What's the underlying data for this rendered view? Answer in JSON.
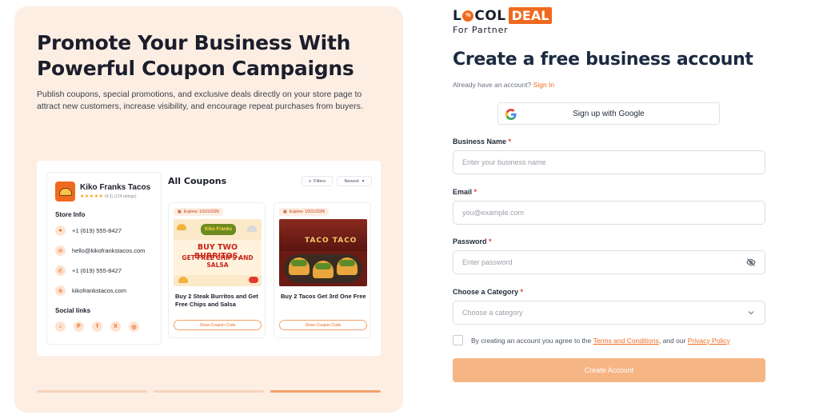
{
  "hero": {
    "title": "Promote Your Business With Powerful Coupon Campaigns",
    "description": "Publish coupons, special promotions, and exclusive deals directly on your store page to attract new customers, increase visibility, and encourage repeat purchases from buyers."
  },
  "store": {
    "name": "Kiko Franks Tacos",
    "stars": "★★★★★",
    "rating_text": "(4.3) (124 ratings)",
    "info_heading": "Store Info",
    "phone_1": "+1 (619) 555-8427",
    "email": "hello@kikofrankstacos.com",
    "phone_2": "+1 (619) 555-8427",
    "website": "kikofrankstacos.com",
    "social_heading": "Social links",
    "social_icons": [
      "tiktok-icon",
      "pinterest-icon",
      "facebook-icon",
      "x-icon",
      "instagram-icon"
    ]
  },
  "coupons": {
    "heading": "All Coupons",
    "filters_label": "Filters",
    "sort_label": "Newest",
    "items": [
      {
        "expires": "Expires: 10/31/2026",
        "image_brand": "Kiko Franks",
        "image_line_1": "BUY TWO BURRITOS,",
        "image_line_2": "GET FREE CHIPS AND SALSA",
        "title": "Buy 2 Steak Burritos and Get Free Chips and Salsa",
        "button": "Show Coupon Code"
      },
      {
        "expires": "Expires: 10/31/2026",
        "image_sign": "TACO TACO",
        "title": "Buy 2 Tacos Get 3rd One Free",
        "button": "Show Coupon Code"
      }
    ]
  },
  "carousel": {
    "active_index": 2,
    "count": 3
  },
  "brand": {
    "logo_part_1": "L",
    "logo_badge": "%",
    "logo_part_2": "COL",
    "logo_deal": "DEAL",
    "subtitle": "For Partner",
    "accent_color": "#ef6a1f"
  },
  "form": {
    "title": "Create a free business account",
    "already_text": "Already have an account?",
    "sign_in_link": "Sign In",
    "google_button": "Sign up with Google",
    "business_name_label": "Business Name",
    "business_name_placeholder": "Enter your business name",
    "email_label": "Email",
    "email_placeholder": "you@example.com",
    "password_label": "Password",
    "password_placeholder": "Enter password",
    "category_label": "Choose a Category",
    "category_placeholder": "Choose a category",
    "required_mark": "*",
    "terms_prefix": "By creating an account you agree to the",
    "terms_link": "Terms and Conditions",
    "terms_middle": ", and our",
    "privacy_link": "Privacy Policy",
    "submit_button": "Create Account"
  }
}
